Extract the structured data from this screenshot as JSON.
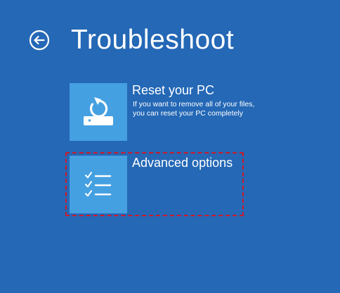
{
  "screen": {
    "title": "Troubleshoot"
  },
  "back_button": {
    "icon": "back-arrow-circle-icon"
  },
  "options": [
    {
      "label": "Reset your PC",
      "description_line1": "If you want to remove all of your files,",
      "description_line2": "you can reset your PC completely",
      "icon": "reset-pc-icon"
    },
    {
      "label": "Advanced options",
      "icon": "checklist-icon",
      "highlighted": true
    }
  ],
  "colors": {
    "background": "#2468b6",
    "tile": "#45a0e1",
    "text": "#ffffff",
    "highlight_border": "#cc1a2a"
  }
}
